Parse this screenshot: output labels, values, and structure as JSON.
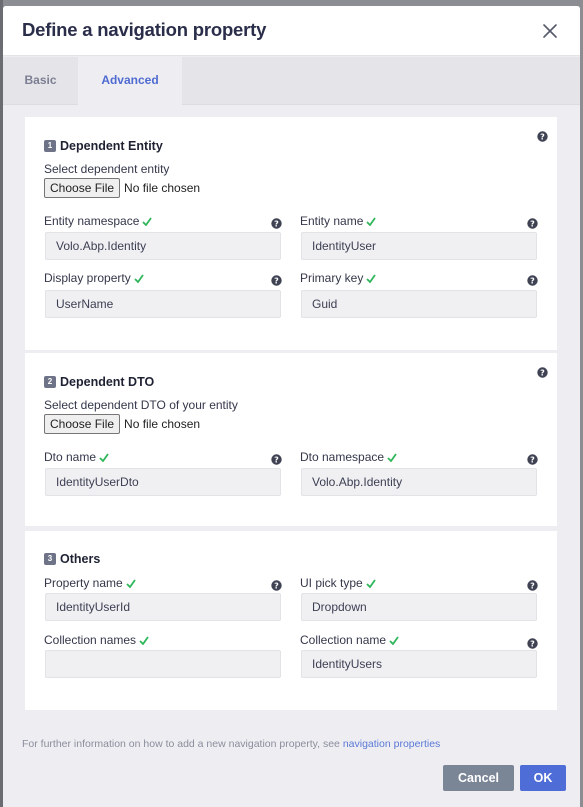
{
  "modal": {
    "title": "Define a navigation property",
    "close_icon": "close-icon"
  },
  "tabs": [
    {
      "label": "Basic",
      "active": false
    },
    {
      "label": "Advanced",
      "active": true
    }
  ],
  "sections": {
    "dependent_entity": {
      "step": "1",
      "title": "Dependent Entity",
      "select_label": "Select dependent entity",
      "file_button": "Choose File",
      "file_status": "No file chosen",
      "fields": {
        "entity_namespace": {
          "label": "Entity namespace",
          "value": "Volo.Abp.Identity"
        },
        "entity_name": {
          "label": "Entity name",
          "value": "IdentityUser"
        },
        "display_property": {
          "label": "Display property",
          "value": "UserName"
        },
        "primary_key": {
          "label": "Primary key",
          "value": "Guid"
        }
      }
    },
    "dependent_dto": {
      "step": "2",
      "title": "Dependent DTO",
      "select_label": "Select dependent DTO of your entity",
      "file_button": "Choose File",
      "file_status": "No file chosen",
      "fields": {
        "dto_name": {
          "label": "Dto name",
          "value": "IdentityUserDto"
        },
        "dto_namespace": {
          "label": "Dto namespace",
          "value": "Volo.Abp.Identity"
        }
      }
    },
    "others": {
      "step": "3",
      "title": "Others",
      "fields": {
        "property_name": {
          "label": "Property name",
          "value": "IdentityUserId"
        },
        "ui_pick_type": {
          "label": "UI pick type",
          "value": "Dropdown"
        },
        "collection_names": {
          "label": "Collection names",
          "value": ""
        },
        "collection_name": {
          "label": "Collection name",
          "value": "IdentityUsers"
        }
      }
    }
  },
  "footer": {
    "note": "For further information on how to add a new navigation property, see",
    "link": "navigation properties",
    "cancel_label": "Cancel",
    "ok_label": "OK"
  },
  "colors": {
    "accent": "#4e6dd6",
    "check": "#2fb65a",
    "cancel": "#7a8596"
  }
}
